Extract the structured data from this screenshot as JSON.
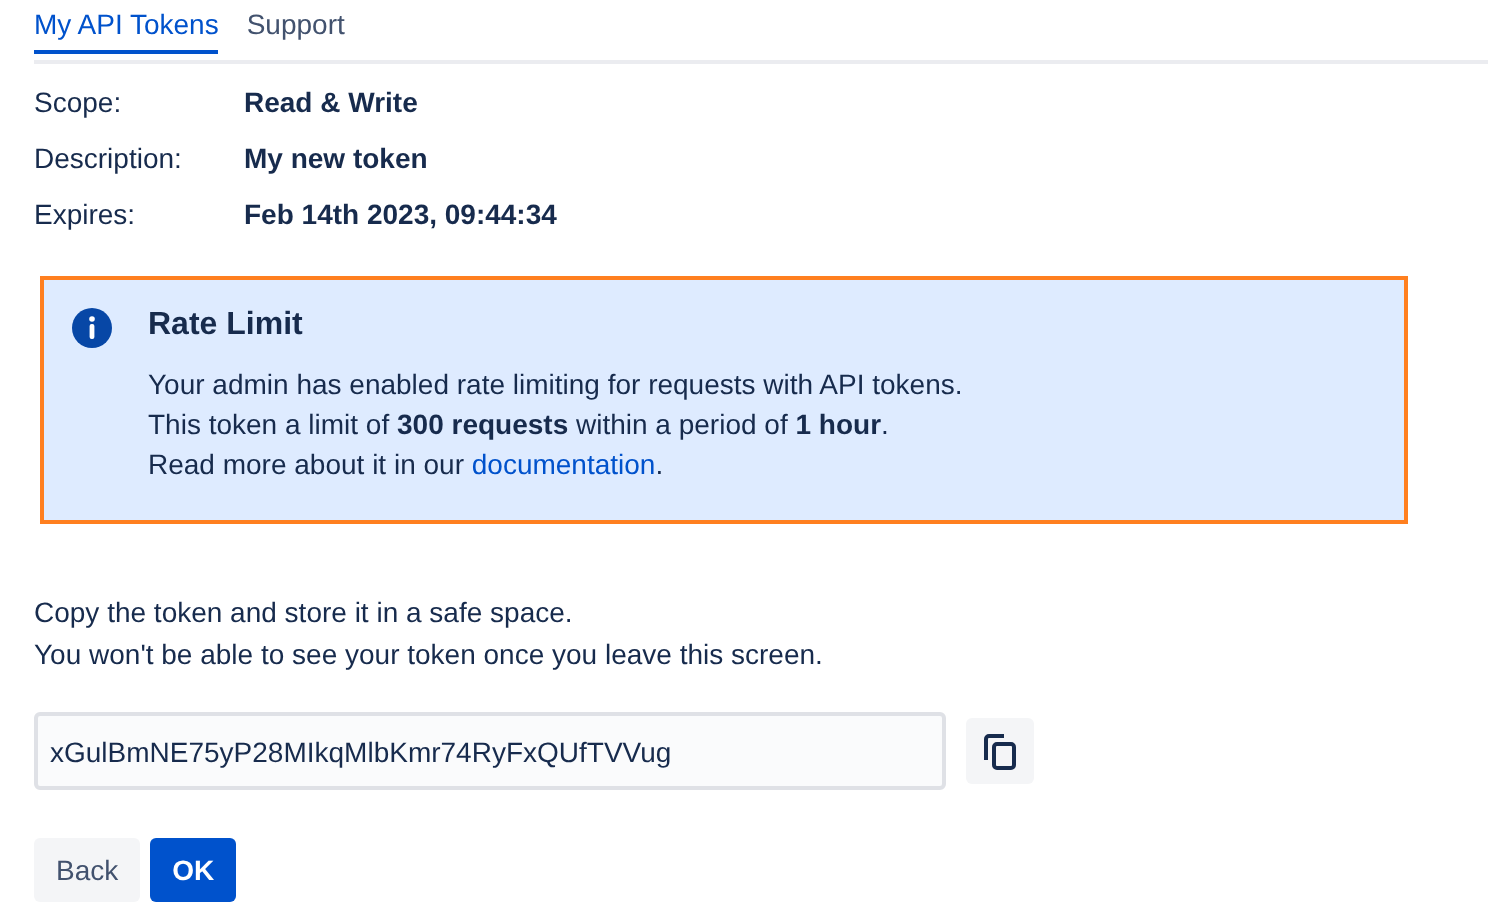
{
  "tabs": [
    {
      "label": "My API Tokens",
      "selected": true
    },
    {
      "label": "Support",
      "selected": false
    }
  ],
  "details": [
    {
      "label": "Scope:",
      "value": "Read & Write"
    },
    {
      "label": "Description:",
      "value": "My new token"
    },
    {
      "label": "Expires:",
      "value": "Feb 14th 2023, 09:44:34"
    }
  ],
  "info_panel": {
    "title": "Rate Limit",
    "highlighted": true,
    "lines": [
      "Your admin has enabled rate limiting for requests with API tokens.",
      "This token a limit of **300 requests** within a period of **1 hour**."
    ],
    "link_line": {
      "before": "Read more about it in our ",
      "link": "documentation",
      "after": "."
    }
  },
  "instructions": [
    "Copy the token and store it in a safe space.",
    "You won't be able to see your token once you leave this screen."
  ],
  "token_field": {
    "value": "xGulBmNE75yP28MIkqMlbKmr74RyFxQUfTVVug"
  },
  "buttons": [
    {
      "label": "Back",
      "kind": "secondary"
    },
    {
      "label": "OK",
      "kind": "primary"
    }
  ]
}
